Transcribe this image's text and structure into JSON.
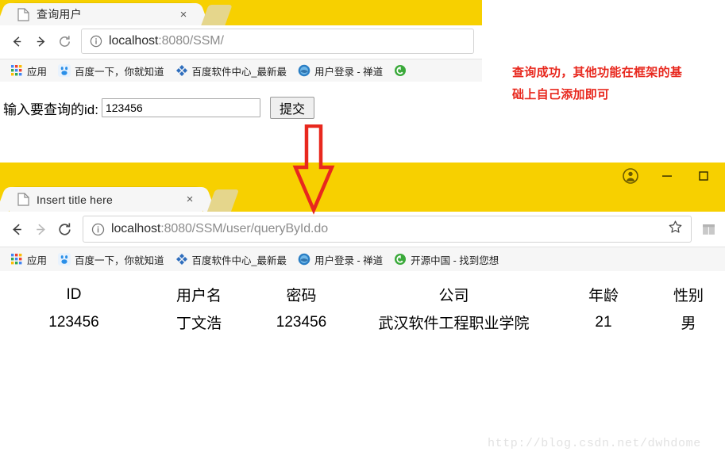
{
  "window_top": {
    "tab": {
      "title": "查询用户",
      "favicon": "page-icon",
      "close": "×"
    },
    "newtab_label": "+",
    "nav": {
      "back": "←",
      "forward": "→",
      "reload": "⟳"
    },
    "omnibox": {
      "info_icon": "info-icon",
      "url_host": "localhost",
      "url_path": ":8080/SSM/"
    },
    "bookmarks": [
      {
        "label": "应用",
        "icon": "apps-grid-icon"
      },
      {
        "label": "百度一下，你就知道",
        "icon": "baidu-icon"
      },
      {
        "label": "百度软件中心_最新最",
        "icon": "baidu-software-icon"
      },
      {
        "label": "用户登录 - 禅道",
        "icon": "zentao-icon"
      },
      {
        "label": "",
        "icon": "oschina-icon"
      }
    ],
    "form": {
      "label": "输入要查询的id:",
      "input_value": "123456",
      "input_placeholder": "",
      "submit_label": "提交"
    }
  },
  "annotation": {
    "text_line1": "查询成功，其他功能在框架的基",
    "text_line2": "础上自己添加即可",
    "color": "#E8281E",
    "arrow": "down-arrow-annotation"
  },
  "window_bottom": {
    "tab": {
      "title": "Insert title here",
      "favicon": "page-icon",
      "close": "×"
    },
    "newtab_label": "+",
    "controls": {
      "profile": "profile-avatar-icon",
      "minimize": "—",
      "maximize": "□"
    },
    "nav": {
      "back": "←",
      "forward": "→",
      "reload": "⟳"
    },
    "omnibox": {
      "info_icon": "info-icon",
      "url_host": "localhost",
      "url_path": ":8080/SSM/user/queryById.do",
      "star_icon": "star-icon"
    },
    "bookmarks": [
      {
        "label": "应用",
        "icon": "apps-grid-icon"
      },
      {
        "label": "百度一下，你就知道",
        "icon": "baidu-icon"
      },
      {
        "label": "百度软件中心_最新最",
        "icon": "baidu-software-icon"
      },
      {
        "label": "用户登录 - 禅道",
        "icon": "zentao-icon"
      },
      {
        "label": "开源中国 - 找到您想",
        "icon": "oschina-icon"
      }
    ],
    "table": {
      "headers": [
        "ID",
        "用户名",
        "密码",
        "公司",
        "年龄",
        "性别"
      ],
      "rows": [
        [
          "123456",
          "丁文浩",
          "123456",
          "武汉软件工程职业学院",
          "21",
          "男"
        ]
      ]
    }
  },
  "watermark": "http://blog.csdn.net/dwhdome",
  "colors": {
    "chrome_yellow": "#F7D000",
    "annotation_red": "#E8281E",
    "tab_bg": "#F6F6F6"
  }
}
